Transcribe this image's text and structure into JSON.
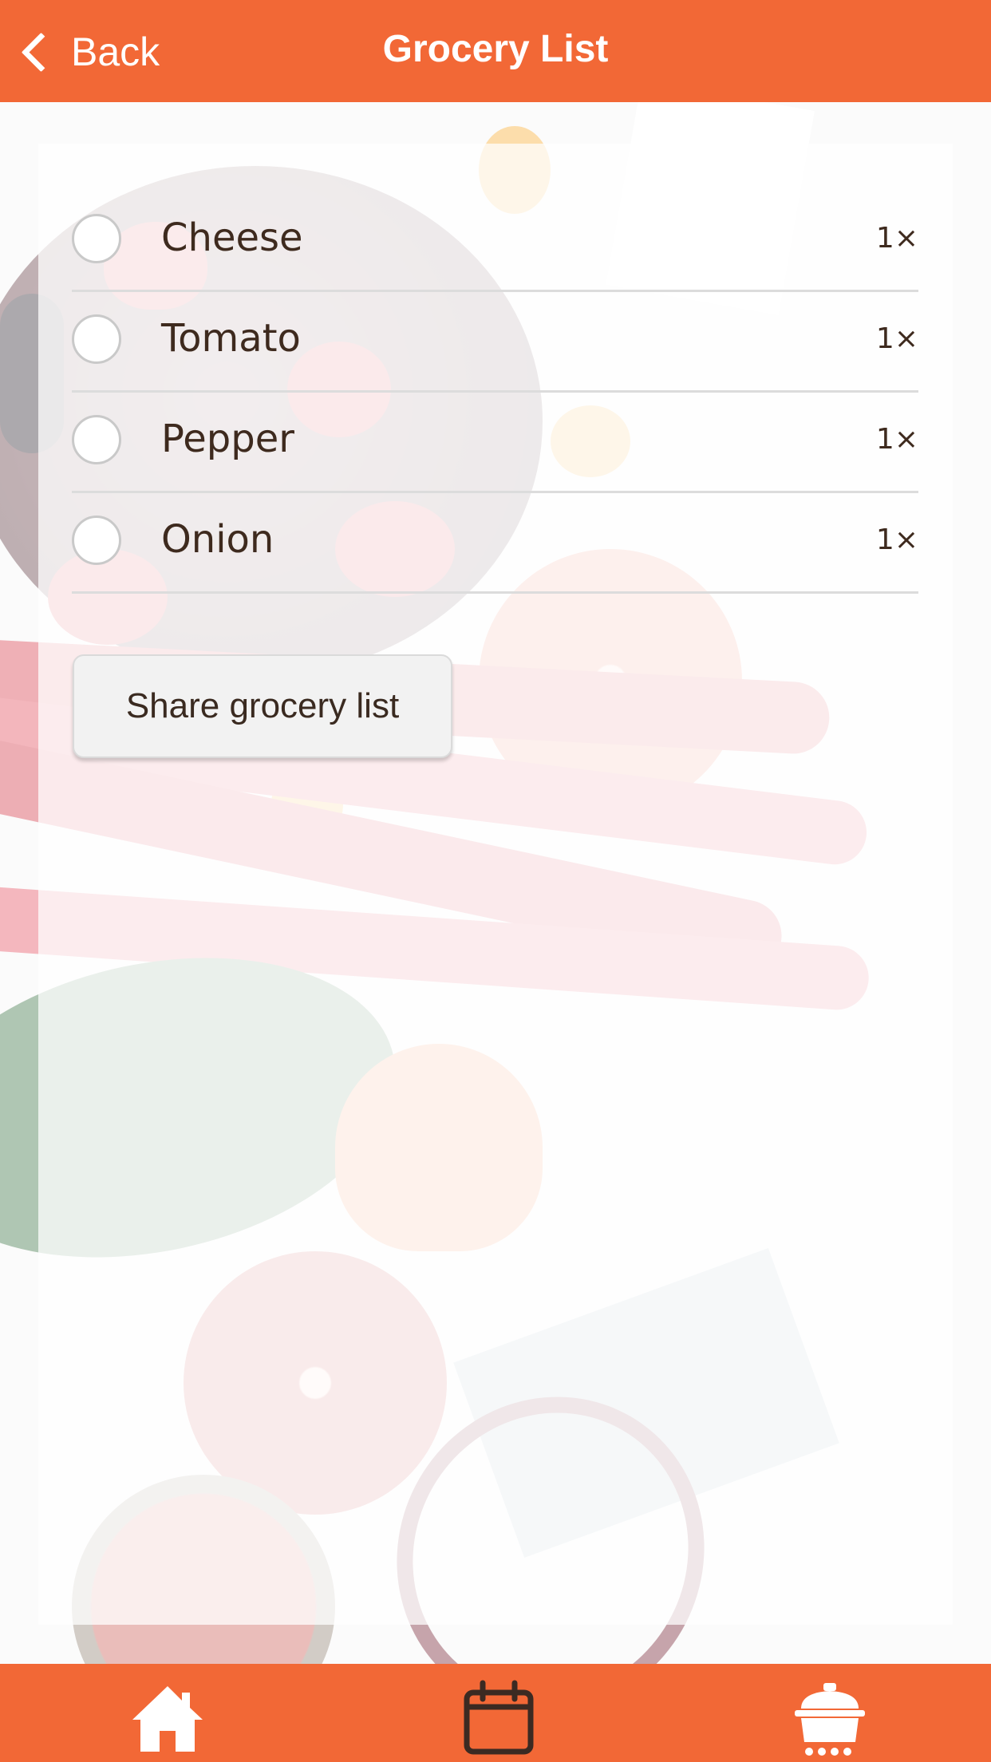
{
  "header": {
    "back_label": "Back",
    "title": "Grocery List"
  },
  "grocery": {
    "items": [
      {
        "name": "Cheese",
        "qty": "1×",
        "checked": false
      },
      {
        "name": "Tomato",
        "qty": "1×",
        "checked": false
      },
      {
        "name": "Pepper",
        "qty": "1×",
        "checked": false
      },
      {
        "name": "Onion",
        "qty": "1×",
        "checked": false
      }
    ],
    "share_label": "Share grocery list"
  },
  "tabbar": {
    "tabs": [
      {
        "icon": "home-icon"
      },
      {
        "icon": "calendar-icon"
      },
      {
        "icon": "cooking-pot-icon"
      }
    ]
  },
  "colors": {
    "accent": "#f26836",
    "text": "#3e2a1e"
  }
}
